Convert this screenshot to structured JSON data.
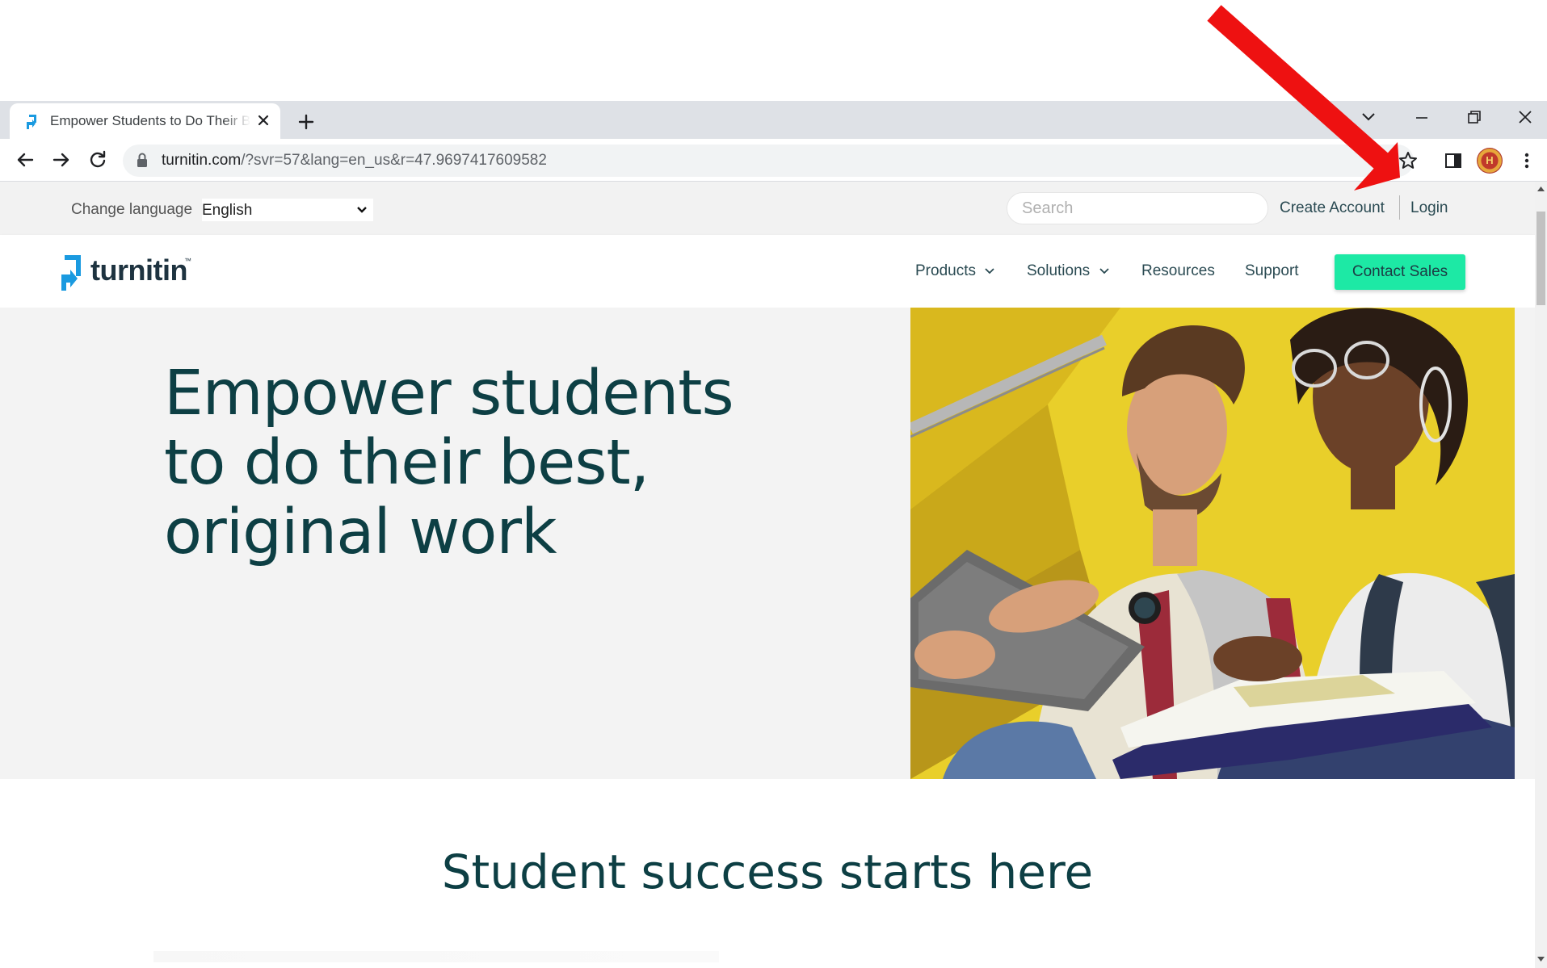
{
  "browser": {
    "tab_title": "Empower Students to Do Their Best, Original Work",
    "url_host": "turnitin.com",
    "url_rest": "/?svr=57&lang=en_us&r=47.9697417609582",
    "profile_initial": "H"
  },
  "utility_bar": {
    "change_language_label": "Change language",
    "language_value": "English",
    "search_placeholder": "Search",
    "create_account": "Create Account",
    "login": "Login"
  },
  "nav": {
    "logo_text": "turnitin",
    "logo_tm": "™",
    "products": "Products",
    "solutions": "Solutions",
    "resources": "Resources",
    "support": "Support",
    "contact_sales": "Contact Sales"
  },
  "hero": {
    "line1": "Empower students",
    "line2": "to do their best,",
    "line3": "original work"
  },
  "section": {
    "title": "Student success starts here"
  },
  "colors": {
    "brand_teal": "#0d3f44",
    "cta_green": "#1de9a5",
    "logo_blue": "#1a9ae0",
    "annotation_red": "#ee1111"
  },
  "icons": [
    "turnitin-favicon-icon",
    "close-icon",
    "plus-icon",
    "chevron-down-icon",
    "minimize-icon",
    "restore-icon",
    "close-window-icon",
    "back-arrow-icon",
    "forward-arrow-icon",
    "reload-icon",
    "lock-icon",
    "star-icon",
    "side-panel-icon",
    "kebab-menu-icon"
  ]
}
